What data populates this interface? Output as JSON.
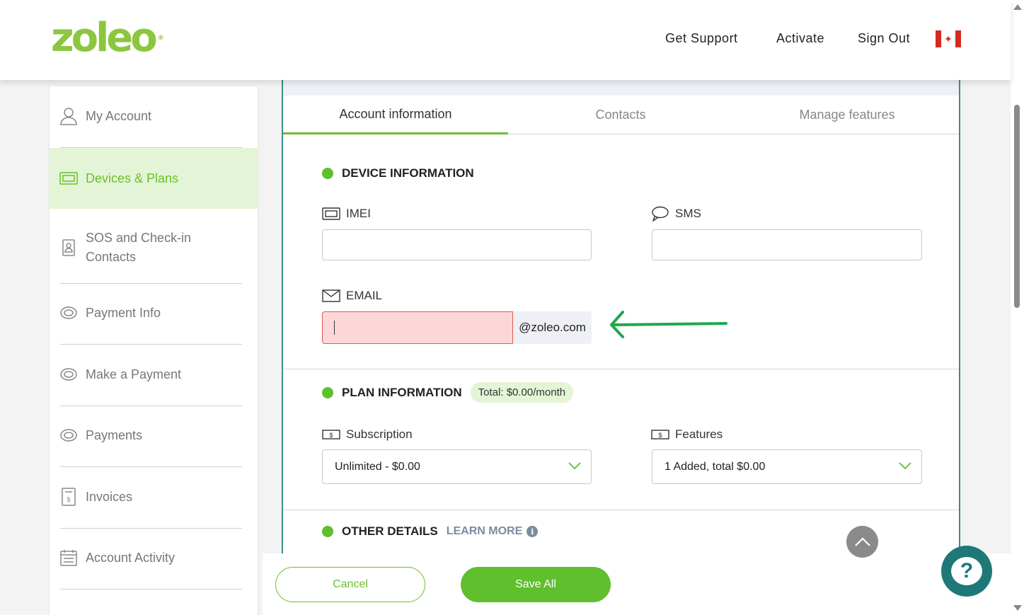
{
  "header": {
    "logo": "zoleo",
    "nav": [
      "Get Support",
      "Activate",
      "Sign Out"
    ]
  },
  "sidebar": {
    "items": [
      {
        "label": "My Account",
        "icon": "user-icon"
      },
      {
        "label": "Devices & Plans",
        "icon": "device-icon",
        "active": true
      },
      {
        "label": "SOS and Check-in Contacts",
        "icon": "contact-book-icon"
      },
      {
        "label": "Payment Info",
        "icon": "coin-icon"
      },
      {
        "label": "Make a Payment",
        "icon": "coin-icon"
      },
      {
        "label": "Payments",
        "icon": "coin-icon"
      },
      {
        "label": "Invoices",
        "icon": "invoice-icon"
      },
      {
        "label": "Account Activity",
        "icon": "calendar-icon"
      }
    ]
  },
  "tabs": [
    "Account information",
    "Contacts",
    "Manage features"
  ],
  "device_section": {
    "title": "DEVICE INFORMATION",
    "imei_label": "IMEI",
    "imei_value": "",
    "sms_label": "SMS",
    "sms_value": "",
    "email_label": "EMAIL",
    "email_value": "",
    "email_suffix": "@zoleo.com"
  },
  "plan_section": {
    "title": "PLAN INFORMATION",
    "total_badge": "Total: $0.00/month",
    "subscription_label": "Subscription",
    "subscription_value": "Unlimited - $0.00",
    "features_label": "Features",
    "features_value": "1 Added, total $0.00"
  },
  "other_section": {
    "title": "OTHER DETAILS",
    "learn_more": "LEARN MORE"
  },
  "actions": {
    "cancel": "Cancel",
    "save": "Save All"
  },
  "colors": {
    "brand_green": "#6bbf2d",
    "teal": "#1f7878",
    "error_bg": "#fdd7d7"
  }
}
